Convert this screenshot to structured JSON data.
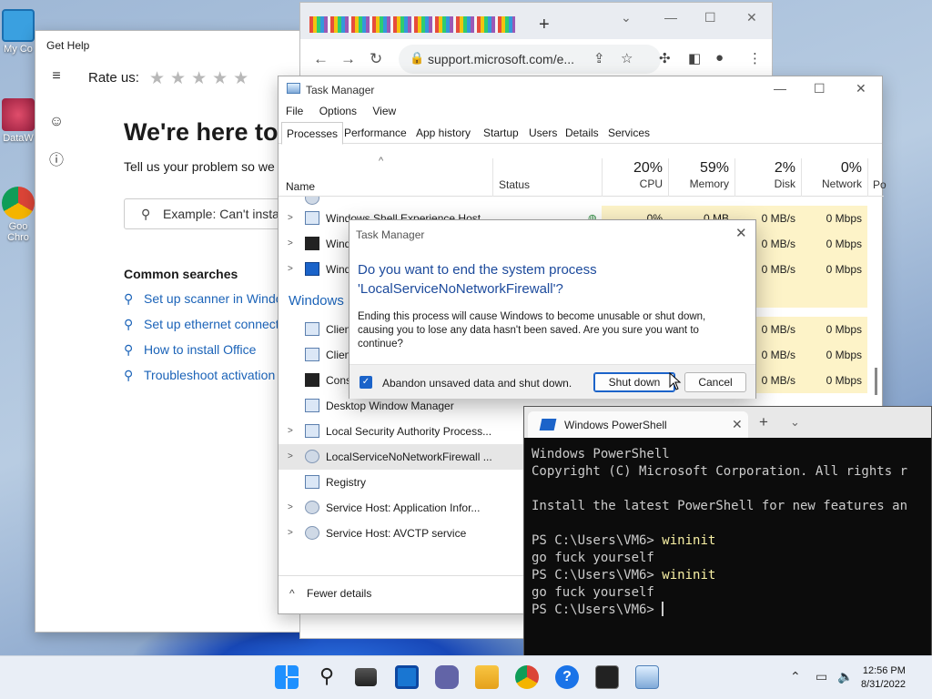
{
  "desktop": {
    "icons": [
      {
        "label": "My Co",
        "icon": "pc-icon"
      },
      {
        "label": "DataW",
        "icon": "datawrapper-icon"
      },
      {
        "label": "Goo Chro",
        "icon": "chrome-icon"
      }
    ]
  },
  "gethelp": {
    "title": "Get Help",
    "rate_label": "Rate us:",
    "stars": "★★★★★",
    "hero": "We're here to",
    "subtitle": "Tell us your problem so we c",
    "search_placeholder": "Example: Can't instal",
    "common_heading": "Common searches",
    "links": [
      "Set up scanner in Windo",
      "Set up ethernet connect",
      "How to install Office",
      "Troubleshoot activation"
    ]
  },
  "chrome": {
    "new_tab": "+",
    "url": "support.microsoft.com/e..."
  },
  "taskmanager": {
    "title": "Task Manager",
    "menu": [
      "File",
      "Options",
      "View"
    ],
    "tabs": [
      "Processes",
      "Performance",
      "App history",
      "Startup",
      "Users",
      "Details",
      "Services"
    ],
    "columns": {
      "name": "Name",
      "status": "Status",
      "cpu_pct": "20%",
      "cpu": "CPU",
      "mem_pct": "59%",
      "mem": "Memory",
      "disk_pct": "2%",
      "disk": "Disk",
      "net_pct": "0%",
      "net": "Network",
      "power": "Po"
    },
    "group_windows": "Windows",
    "rows": [
      {
        "name": "Windows Shell Experience Host",
        "cpu": "0%",
        "mem": "0 MB",
        "disk": "0 MB/s",
        "net": "0 Mbps"
      },
      {
        "name": "Wind",
        "disk": "0 MB/s",
        "net": "0 Mbps"
      },
      {
        "name": "Wind",
        "disk": "0 MB/s",
        "net": "0 Mbps"
      },
      {
        "name": "Clien",
        "disk": "0 MB/s",
        "net": "0 Mbps"
      },
      {
        "name": "Clien",
        "disk": "0 MB/s",
        "net": "0 Mbps"
      },
      {
        "name": "Cons",
        "disk": "0 MB/s",
        "net": "0 Mbps"
      },
      {
        "name": "Desktop Window Manager"
      },
      {
        "name": "Local Security Authority Process..."
      },
      {
        "name": "LocalServiceNoNetworkFirewall ..."
      },
      {
        "name": "Registry"
      },
      {
        "name": "Service Host: Application Infor..."
      },
      {
        "name": "Service Host: AVCTP service"
      }
    ],
    "fewer_details": "Fewer details"
  },
  "dialog": {
    "title": "Task Manager",
    "question_line1": "Do you want to end the system process",
    "question_line2": "'LocalServiceNoNetworkFirewall'?",
    "body": "Ending this process will cause Windows to become unusable or shut down, causing you to lose any data hasn't been saved. Are you sure you want to continue?",
    "checkbox_label": "Abandon unsaved data and shut down.",
    "shutdown_label": "Shut down",
    "cancel_label": "Cancel"
  },
  "powershell": {
    "tab_title": "Windows PowerShell",
    "lines": [
      {
        "text": "Windows PowerShell"
      },
      {
        "text": "Copyright (C) Microsoft Corporation. All rights r"
      },
      {
        "text": ""
      },
      {
        "text": "Install the latest PowerShell for new features an"
      },
      {
        "text": ""
      },
      {
        "prompt": "PS C:\\Users\\VM6> ",
        "cmd": "wininit"
      },
      {
        "text": "go fuck yourself"
      },
      {
        "prompt": "PS C:\\Users\\VM6> ",
        "cmd": "wininit"
      },
      {
        "text": "go fuck yourself"
      },
      {
        "prompt": "PS C:\\Users\\VM6> ",
        "cmd": ""
      }
    ]
  },
  "taskbar": {
    "time": "12:56 PM",
    "date": "8/31/2022"
  }
}
